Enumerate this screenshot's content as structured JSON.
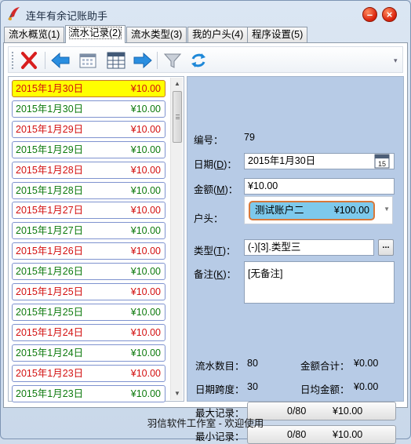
{
  "window": {
    "title": "连年有余记账助手",
    "minimize_glyph": "–",
    "close_glyph": "×"
  },
  "tabs": [
    {
      "label": "流水概览(1)",
      "active": false
    },
    {
      "label": "流水记录(2)",
      "active": true
    },
    {
      "label": "流水类型(3)",
      "active": false
    },
    {
      "label": "我的户头(4)",
      "active": false
    },
    {
      "label": "程序设置(5)",
      "active": false
    }
  ],
  "toolbar": {
    "icons": [
      "delete-icon",
      "back-arrow-icon",
      "calendar-icon",
      "calendar-grid-icon",
      "forward-arrow-icon",
      "filter-icon",
      "refresh-icon"
    ]
  },
  "list": {
    "items": [
      {
        "date": "2015年1月30日",
        "amount": "¥10.00",
        "color": "red",
        "selected": true
      },
      {
        "date": "2015年1月30日",
        "amount": "¥10.00",
        "color": "green"
      },
      {
        "date": "2015年1月29日",
        "amount": "¥10.00",
        "color": "red"
      },
      {
        "date": "2015年1月29日",
        "amount": "¥10.00",
        "color": "green"
      },
      {
        "date": "2015年1月28日",
        "amount": "¥10.00",
        "color": "red"
      },
      {
        "date": "2015年1月28日",
        "amount": "¥10.00",
        "color": "green"
      },
      {
        "date": "2015年1月27日",
        "amount": "¥10.00",
        "color": "red"
      },
      {
        "date": "2015年1月27日",
        "amount": "¥10.00",
        "color": "green"
      },
      {
        "date": "2015年1月26日",
        "amount": "¥10.00",
        "color": "red"
      },
      {
        "date": "2015年1月26日",
        "amount": "¥10.00",
        "color": "green"
      },
      {
        "date": "2015年1月25日",
        "amount": "¥10.00",
        "color": "red"
      },
      {
        "date": "2015年1月25日",
        "amount": "¥10.00",
        "color": "green"
      },
      {
        "date": "2015年1月24日",
        "amount": "¥10.00",
        "color": "red"
      },
      {
        "date": "2015年1月24日",
        "amount": "¥10.00",
        "color": "green"
      },
      {
        "date": "2015年1月23日",
        "amount": "¥10.00",
        "color": "red"
      },
      {
        "date": "2015年1月23日",
        "amount": "¥10.00",
        "color": "green"
      }
    ]
  },
  "detail": {
    "id_label": "编号：",
    "id_value": "79",
    "date_label_pre": "日期(",
    "date_label_key": "D",
    "date_label_post": ")：",
    "date_value": "2015年1月30日",
    "calendar_day": "15",
    "amount_label_pre": "金额(",
    "amount_label_key": "M",
    "amount_label_post": ")：",
    "amount_value": "¥10.00",
    "account_label": "户头：",
    "account_name": "测试账户二",
    "account_balance": "¥100.00",
    "type_label_pre": "类型(",
    "type_label_key": "T",
    "type_label_post": ")：",
    "type_value": "(-)[3].类型三",
    "type_button": "...",
    "memo_label_pre": "备注(",
    "memo_label_key": "K",
    "memo_label_post": ")：",
    "memo_value": "[无备注]"
  },
  "stats": {
    "count_label": "流水数目：",
    "count_value": "80",
    "total_label": "金额合计：",
    "total_value": "¥0.00",
    "span_label": "日期跨度：",
    "span_value": "30",
    "daily_avg_label": "日均金额：",
    "daily_avg_value": "¥0.00",
    "max_label": "最大记录：",
    "max_count": "0/80",
    "max_amount": "¥10.00",
    "min_label": "最小记录：",
    "min_count": "0/80",
    "min_amount": "¥10.00"
  },
  "status_bar": {
    "text": "羽信软件工作室 - 欢迎使用"
  },
  "colors": {
    "red_text": "#d31010",
    "green_text": "#0d7a0d",
    "selected_bg": "#ffff00",
    "detail_bg": "#b7cbe6",
    "account_pill": "#7dc9ec"
  }
}
